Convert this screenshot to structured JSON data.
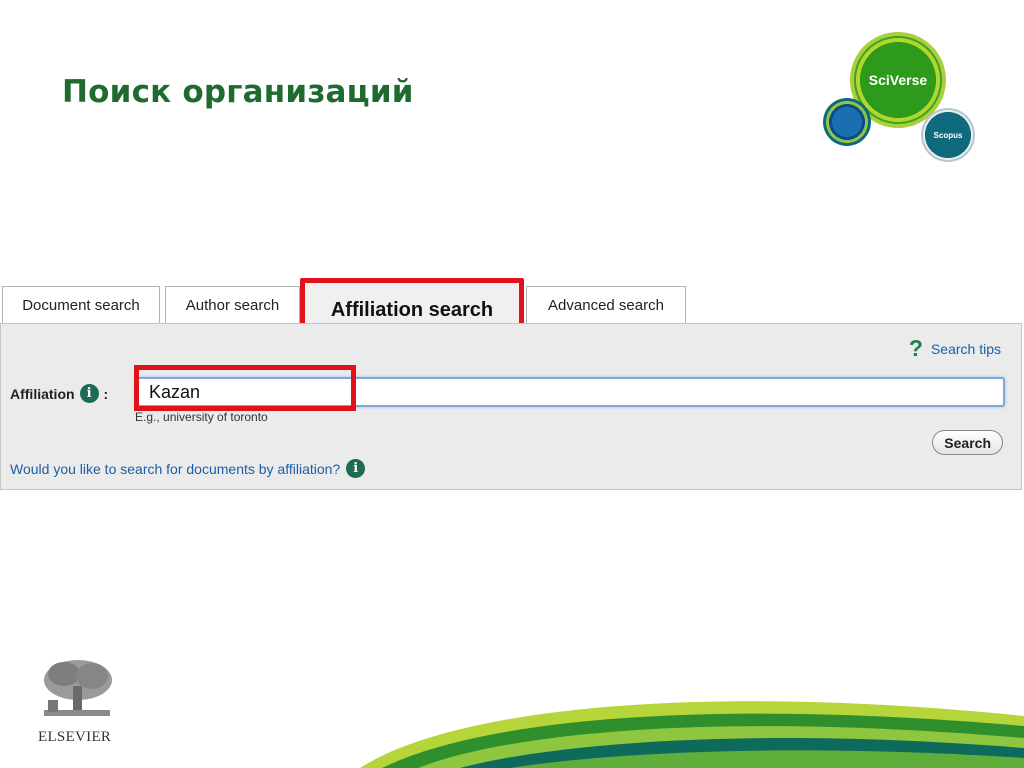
{
  "slide": {
    "title": "Поиск организаций"
  },
  "logo": {
    "sciverse": "SciVerse",
    "scopus": "Scopus"
  },
  "tabs": [
    {
      "label": "Document search",
      "active": false
    },
    {
      "label": "Author search",
      "active": false
    },
    {
      "label": "Affiliation search",
      "active": true
    },
    {
      "label": "Advanced search",
      "active": false
    }
  ],
  "panel": {
    "search_tips": "Search tips",
    "affiliation_label": "Affiliation",
    "affiliation_value": "Kazan",
    "example_text": "E.g., university of toronto",
    "search_button": "Search",
    "doc_link": "Would you like to search for documents by affiliation?"
  },
  "footer": {
    "publisher": "ELSEVIER"
  },
  "colors": {
    "title": "#1f6b2f",
    "highlight": "#e1121b",
    "link": "#1a5fa6",
    "panel": "#ebebeb"
  }
}
